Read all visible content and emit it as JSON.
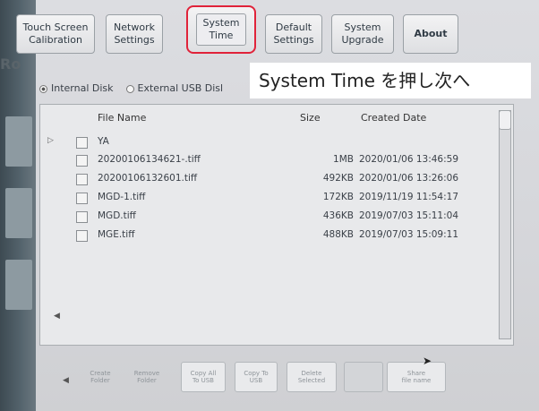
{
  "tabs": [
    {
      "label": "Touch Screen\nCalibration",
      "selected": false
    },
    {
      "label": "Network\nSettings",
      "selected": false
    },
    {
      "label": "System\nTime",
      "selected": true
    },
    {
      "label": "Default\nSettings",
      "selected": false
    },
    {
      "label": "System\nUpgrade",
      "selected": false
    },
    {
      "label": "About",
      "selected": false
    }
  ],
  "side_label": "Ro",
  "caption": "System Time を押し次へ",
  "storage": {
    "internal": "Internal Disk",
    "external": "External USB Disl"
  },
  "columns": {
    "name": "File Name",
    "size": "Size",
    "date": "Created Date"
  },
  "folder": "YA",
  "files": [
    {
      "name": "20200106134621-.tiff",
      "size": "1MB",
      "date": "2020/01/06 13:46:59"
    },
    {
      "name": "20200106132601.tiff",
      "size": "492KB",
      "date": "2020/01/06 13:26:06"
    },
    {
      "name": "MGD-1.tiff",
      "size": "172KB",
      "date": "2019/11/19 11:54:17"
    },
    {
      "name": "MGD.tiff",
      "size": "436KB",
      "date": "2019/07/03 15:11:04"
    },
    {
      "name": "MGE.tiff",
      "size": "488KB",
      "date": "2019/07/03 15:09:11"
    }
  ],
  "buttons": [
    {
      "label": "Create\nFolder"
    },
    {
      "label": "Remove\nFolder"
    },
    {
      "label": "Copy All\nTo USB"
    },
    {
      "label": "Copy To\nUSB"
    },
    {
      "label": "Delete\nSelected"
    },
    {
      "label": ""
    },
    {
      "label": "Share\nfile name"
    }
  ],
  "colors": {
    "highlight": "#e0233a",
    "panel": "#e8e9eb"
  }
}
